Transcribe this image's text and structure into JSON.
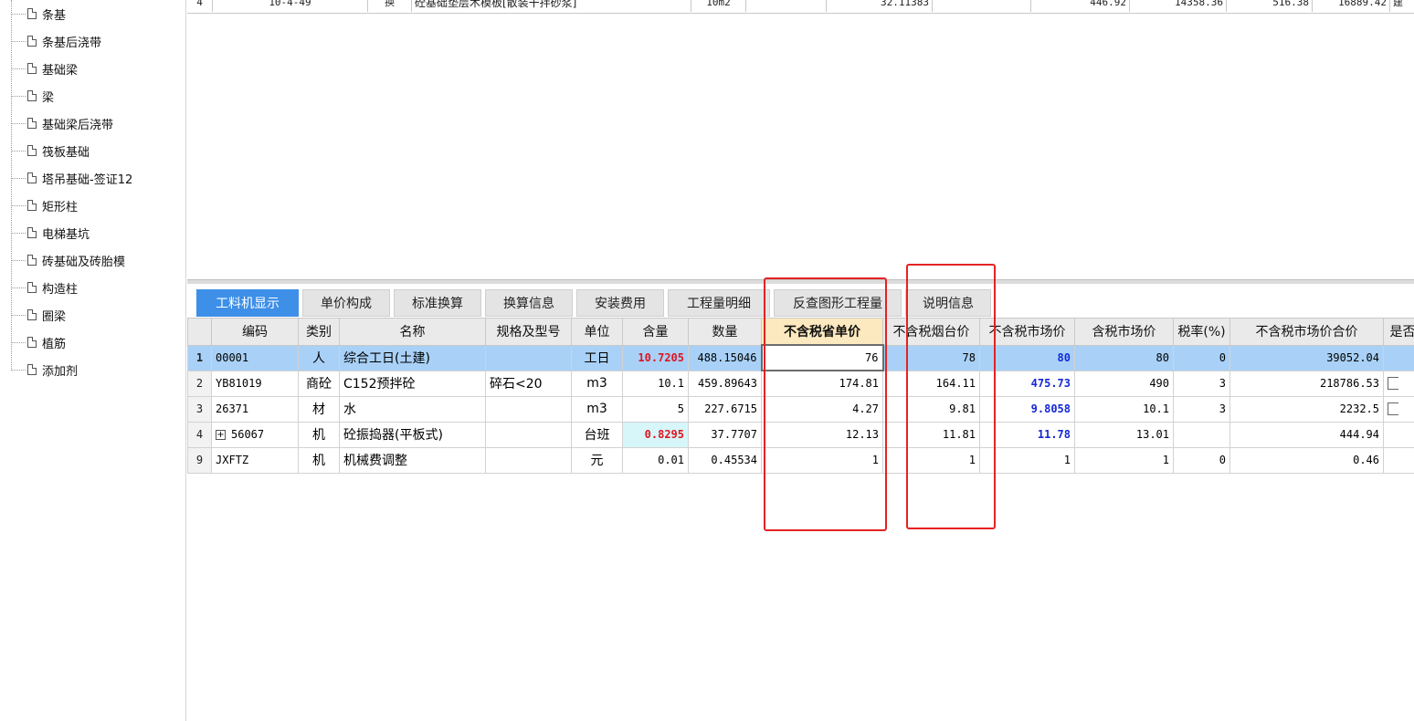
{
  "tree": {
    "items": [
      {
        "label": "条基"
      },
      {
        "label": "条基后浇带"
      },
      {
        "label": "基础梁"
      },
      {
        "label": "梁"
      },
      {
        "label": "基础梁后浇带"
      },
      {
        "label": "筏板基础"
      },
      {
        "label": "塔吊基础-签证12"
      },
      {
        "label": "矩形柱"
      },
      {
        "label": "电梯基坑"
      },
      {
        "label": "砖基础及砖胎模"
      },
      {
        "label": "构造柱"
      },
      {
        "label": "圈梁"
      },
      {
        "label": "植筋"
      },
      {
        "label": "添加剂"
      }
    ]
  },
  "upper_grid": {
    "row": {
      "num": "4",
      "code": "10-4-49",
      "mark": "换",
      "name": "砼基础垫层木模板[散装干拌砂浆]",
      "unit": "10m2",
      "qty": "32.11383",
      "price": "446.92",
      "total": "14358.36",
      "c1": "516.38",
      "c2": "16889.42",
      "c3": "建"
    }
  },
  "tabs": [
    {
      "label": "工料机显示",
      "active": true
    },
    {
      "label": "单价构成"
    },
    {
      "label": "标准换算"
    },
    {
      "label": "换算信息"
    },
    {
      "label": "安装费用"
    },
    {
      "label": "工程量明细"
    },
    {
      "label": "反查图形工程量"
    },
    {
      "label": "说明信息"
    }
  ],
  "grid": {
    "headers": {
      "code": "编码",
      "type": "类别",
      "name": "名称",
      "spec": "规格及型号",
      "unit": "单位",
      "content": "含量",
      "qty": "数量",
      "price_excl": "不含税省单价",
      "price_tai": "不含税烟台价",
      "market_excl": "不含税市场价",
      "market_incl": "含税市场价",
      "tax": "税率(%)",
      "market_total": "不含税市场价合价",
      "flag": "是否"
    },
    "rows": [
      {
        "num": "1",
        "code": "00001",
        "type": "人",
        "name": "综合工日(土建)",
        "spec": "",
        "unit": "工日",
        "content": "10.7205",
        "qty": "488.15046",
        "price_excl": "76",
        "price_tai": "78",
        "market_excl": "80",
        "market_incl": "80",
        "tax": "0",
        "market_total": "39052.04"
      },
      {
        "num": "2",
        "code": "YB81019",
        "type": "商砼",
        "name": "C152预拌砼",
        "spec": "碎石<20",
        "unit": "m3",
        "content": "10.1",
        "qty": "459.89643",
        "price_excl": "174.81",
        "price_tai": "164.11",
        "market_excl": "475.73",
        "market_incl": "490",
        "tax": "3",
        "market_total": "218786.53"
      },
      {
        "num": "3",
        "code": "26371",
        "type": "材",
        "name": "水",
        "spec": "",
        "unit": "m3",
        "content": "5",
        "qty": "227.6715",
        "price_excl": "4.27",
        "price_tai": "9.81",
        "market_excl": "9.8058",
        "market_incl": "10.1",
        "tax": "3",
        "market_total": "2232.5"
      },
      {
        "num": "4",
        "expand": "+",
        "code": "56067",
        "type": "机",
        "name": "砼振捣器(平板式)",
        "spec": "",
        "unit": "台班",
        "content": "0.8295",
        "qty": "37.7707",
        "price_excl": "12.13",
        "price_tai": "11.81",
        "market_excl": "11.78",
        "market_incl": "13.01",
        "tax": "",
        "market_total": "444.94"
      },
      {
        "num": "9",
        "code": "JXFTZ",
        "type": "机",
        "name": "机械费调整",
        "spec": "",
        "unit": "元",
        "content": "0.01",
        "qty": "0.45534",
        "price_excl": "1",
        "price_tai": "1",
        "market_excl": "1",
        "market_incl": "1",
        "tax": "0",
        "market_total": "0.46"
      }
    ]
  },
  "colors": {
    "active_tab": "#3d8fe8",
    "selected_row": "#a9d1f7",
    "header_highlight": "#fde9bf",
    "red_value": "#e0141e",
    "blue_value": "#1428d8",
    "annotation_box": "#e52222"
  }
}
